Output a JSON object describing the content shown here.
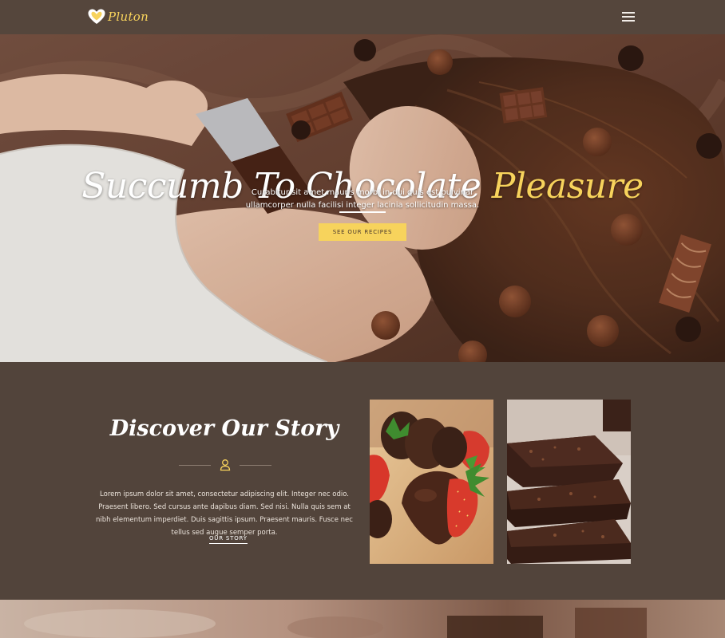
{
  "navbar": {
    "brand_name": "Pluton",
    "brand_icon": "heart-logo-icon",
    "menu_icon": "hamburger-menu-icon"
  },
  "hero": {
    "title_main": "Succumb To Chocolate ",
    "title_accent": "Pleasure",
    "subtitle": "Curabitur sit amet mauris morbi in dui quis est pulvinar ullamcorper nulla facilisi integer lacinia sollicitudin massa.",
    "button_label": "SEE OUR RECIPES"
  },
  "story": {
    "title": "Discover Our Story",
    "divider_icon": "user-icon",
    "body": "Lorem ipsum dolor sit amet, consectetur adipiscing elit. Integer nec odio. Praesent libero. Sed cursus ante dapibus diam. Sed nisi. Nulla quis sem at nibh elementum imperdiet. Duis sagittis ipsum. Praesent mauris. Fusce nec tellus sed augue semper porta.",
    "link_label": "OUR STORY"
  },
  "colors": {
    "brand_yellow": "#f7d35c",
    "dark_brown": "#52443b",
    "nav_brown": "#55463c"
  }
}
